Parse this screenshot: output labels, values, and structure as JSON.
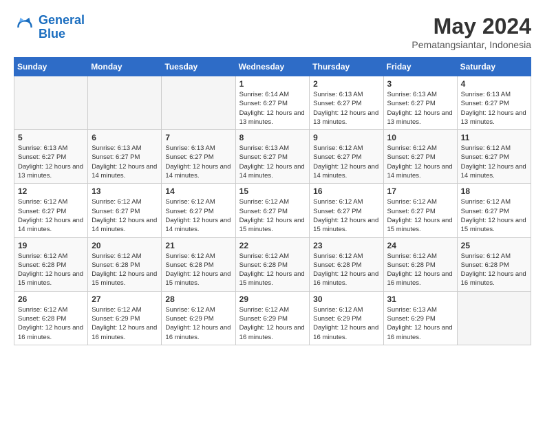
{
  "header": {
    "logo_line1": "General",
    "logo_line2": "Blue",
    "month": "May 2024",
    "location": "Pematangsiantar, Indonesia"
  },
  "weekdays": [
    "Sunday",
    "Monday",
    "Tuesday",
    "Wednesday",
    "Thursday",
    "Friday",
    "Saturday"
  ],
  "weeks": [
    [
      {
        "day": "",
        "empty": true
      },
      {
        "day": "",
        "empty": true
      },
      {
        "day": "",
        "empty": true
      },
      {
        "day": "1",
        "sunrise": "6:14 AM",
        "sunset": "6:27 PM",
        "daylight": "12 hours and 13 minutes."
      },
      {
        "day": "2",
        "sunrise": "6:13 AM",
        "sunset": "6:27 PM",
        "daylight": "12 hours and 13 minutes."
      },
      {
        "day": "3",
        "sunrise": "6:13 AM",
        "sunset": "6:27 PM",
        "daylight": "12 hours and 13 minutes."
      },
      {
        "day": "4",
        "sunrise": "6:13 AM",
        "sunset": "6:27 PM",
        "daylight": "12 hours and 13 minutes."
      }
    ],
    [
      {
        "day": "5",
        "sunrise": "6:13 AM",
        "sunset": "6:27 PM",
        "daylight": "12 hours and 13 minutes."
      },
      {
        "day": "6",
        "sunrise": "6:13 AM",
        "sunset": "6:27 PM",
        "daylight": "12 hours and 14 minutes."
      },
      {
        "day": "7",
        "sunrise": "6:13 AM",
        "sunset": "6:27 PM",
        "daylight": "12 hours and 14 minutes."
      },
      {
        "day": "8",
        "sunrise": "6:13 AM",
        "sunset": "6:27 PM",
        "daylight": "12 hours and 14 minutes."
      },
      {
        "day": "9",
        "sunrise": "6:12 AM",
        "sunset": "6:27 PM",
        "daylight": "12 hours and 14 minutes."
      },
      {
        "day": "10",
        "sunrise": "6:12 AM",
        "sunset": "6:27 PM",
        "daylight": "12 hours and 14 minutes."
      },
      {
        "day": "11",
        "sunrise": "6:12 AM",
        "sunset": "6:27 PM",
        "daylight": "12 hours and 14 minutes."
      }
    ],
    [
      {
        "day": "12",
        "sunrise": "6:12 AM",
        "sunset": "6:27 PM",
        "daylight": "12 hours and 14 minutes."
      },
      {
        "day": "13",
        "sunrise": "6:12 AM",
        "sunset": "6:27 PM",
        "daylight": "12 hours and 14 minutes."
      },
      {
        "day": "14",
        "sunrise": "6:12 AM",
        "sunset": "6:27 PM",
        "daylight": "12 hours and 14 minutes."
      },
      {
        "day": "15",
        "sunrise": "6:12 AM",
        "sunset": "6:27 PM",
        "daylight": "12 hours and 15 minutes."
      },
      {
        "day": "16",
        "sunrise": "6:12 AM",
        "sunset": "6:27 PM",
        "daylight": "12 hours and 15 minutes."
      },
      {
        "day": "17",
        "sunrise": "6:12 AM",
        "sunset": "6:27 PM",
        "daylight": "12 hours and 15 minutes."
      },
      {
        "day": "18",
        "sunrise": "6:12 AM",
        "sunset": "6:27 PM",
        "daylight": "12 hours and 15 minutes."
      }
    ],
    [
      {
        "day": "19",
        "sunrise": "6:12 AM",
        "sunset": "6:28 PM",
        "daylight": "12 hours and 15 minutes."
      },
      {
        "day": "20",
        "sunrise": "6:12 AM",
        "sunset": "6:28 PM",
        "daylight": "12 hours and 15 minutes."
      },
      {
        "day": "21",
        "sunrise": "6:12 AM",
        "sunset": "6:28 PM",
        "daylight": "12 hours and 15 minutes."
      },
      {
        "day": "22",
        "sunrise": "6:12 AM",
        "sunset": "6:28 PM",
        "daylight": "12 hours and 15 minutes."
      },
      {
        "day": "23",
        "sunrise": "6:12 AM",
        "sunset": "6:28 PM",
        "daylight": "12 hours and 16 minutes."
      },
      {
        "day": "24",
        "sunrise": "6:12 AM",
        "sunset": "6:28 PM",
        "daylight": "12 hours and 16 minutes."
      },
      {
        "day": "25",
        "sunrise": "6:12 AM",
        "sunset": "6:28 PM",
        "daylight": "12 hours and 16 minutes."
      }
    ],
    [
      {
        "day": "26",
        "sunrise": "6:12 AM",
        "sunset": "6:28 PM",
        "daylight": "12 hours and 16 minutes."
      },
      {
        "day": "27",
        "sunrise": "6:12 AM",
        "sunset": "6:29 PM",
        "daylight": "12 hours and 16 minutes."
      },
      {
        "day": "28",
        "sunrise": "6:12 AM",
        "sunset": "6:29 PM",
        "daylight": "12 hours and 16 minutes."
      },
      {
        "day": "29",
        "sunrise": "6:12 AM",
        "sunset": "6:29 PM",
        "daylight": "12 hours and 16 minutes."
      },
      {
        "day": "30",
        "sunrise": "6:12 AM",
        "sunset": "6:29 PM",
        "daylight": "12 hours and 16 minutes."
      },
      {
        "day": "31",
        "sunrise": "6:13 AM",
        "sunset": "6:29 PM",
        "daylight": "12 hours and 16 minutes."
      },
      {
        "day": "",
        "empty": true
      }
    ]
  ]
}
